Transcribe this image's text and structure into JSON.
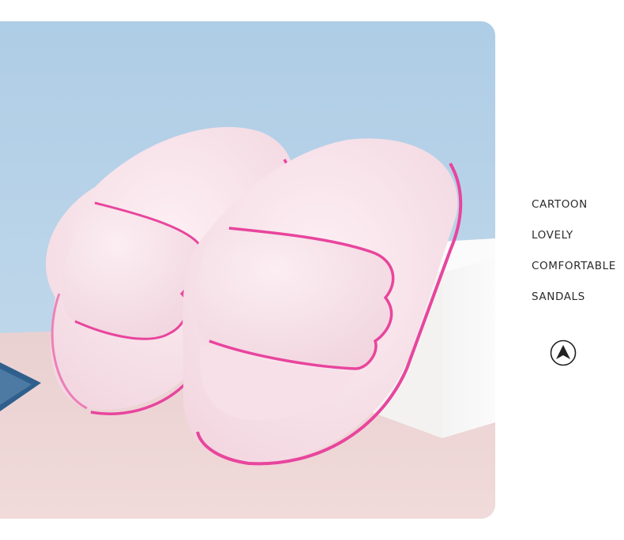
{
  "product_photo": {
    "alt": "",
    "colors": {
      "sky": "#bcd6ea",
      "table": "#ecd3d3",
      "slipper_body": "#f8e3ea",
      "slipper_trim": "#e8459d",
      "block": "#f6f5f4"
    }
  },
  "features": [
    {
      "label": "CARTOON"
    },
    {
      "label": "LOVELY"
    },
    {
      "label": "COMFORTABLE"
    },
    {
      "label": "SANDALS"
    }
  ],
  "nav": {
    "icon": "arrow-up-circle-icon"
  }
}
